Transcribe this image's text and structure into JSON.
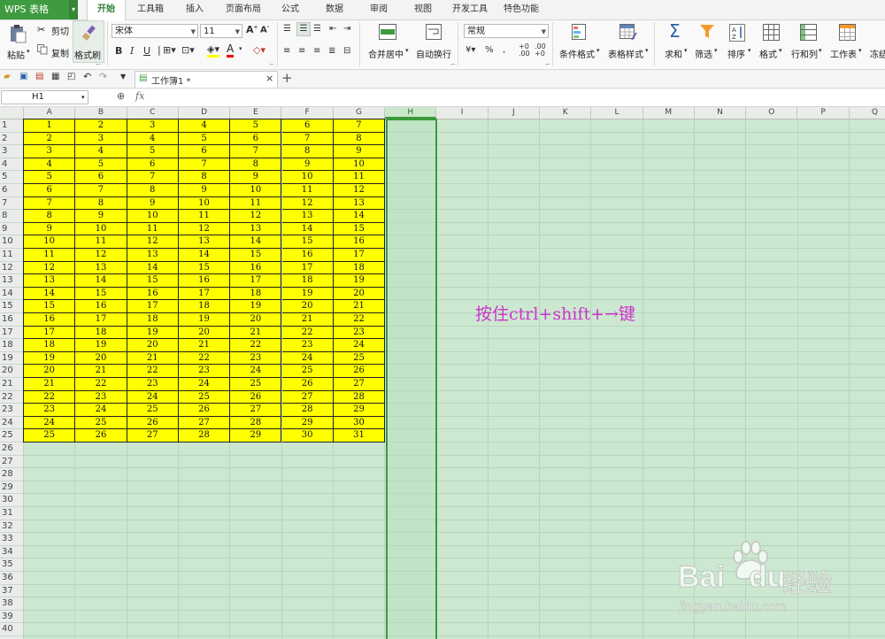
{
  "app": {
    "name": "WPS 表格"
  },
  "menu": {
    "tabs": [
      "开始",
      "工具箱",
      "插入",
      "页面布局",
      "公式",
      "数据",
      "审阅",
      "视图",
      "开发工具",
      "特色功能"
    ],
    "active_index": 0
  },
  "ribbon": {
    "paste": "粘贴",
    "cut": "剪切",
    "copy": "复制",
    "format_painter": "格式刷",
    "font_name": "宋体",
    "font_size": "11",
    "merge_center": "合并居中",
    "wrap_text": "自动换行",
    "number_format": "常规",
    "conditional_format": "条件格式",
    "table_style": "表格样式",
    "sum": "求和",
    "filter": "筛选",
    "sort": "排序",
    "format": "格式",
    "row_col": "行和列",
    "worksheet": "工作表",
    "freeze": "冻结"
  },
  "workbook_tab": {
    "title": "工作簿1 *"
  },
  "formula_bar": {
    "cell_ref": "H1",
    "fx": "fx",
    "value": ""
  },
  "sheet": {
    "columns": [
      "A",
      "B",
      "C",
      "D",
      "E",
      "F",
      "G",
      "H",
      "I",
      "J",
      "K",
      "L",
      "M",
      "N",
      "O",
      "P",
      "Q"
    ],
    "selected_column": "H",
    "row_count": 40,
    "data_rows": 25,
    "data_cols": 7,
    "fill_color": "#ffff00",
    "data_rule": "cell value = row number + column index (A=0 … G=6)"
  },
  "annotation": {
    "text": "按住ctrl+shift+→键",
    "color": "#cc33cc"
  },
  "watermark": {
    "brand": "Bai",
    "brand2": "du",
    "suffix": "经验",
    "url": "jingyan.baidu.com"
  }
}
